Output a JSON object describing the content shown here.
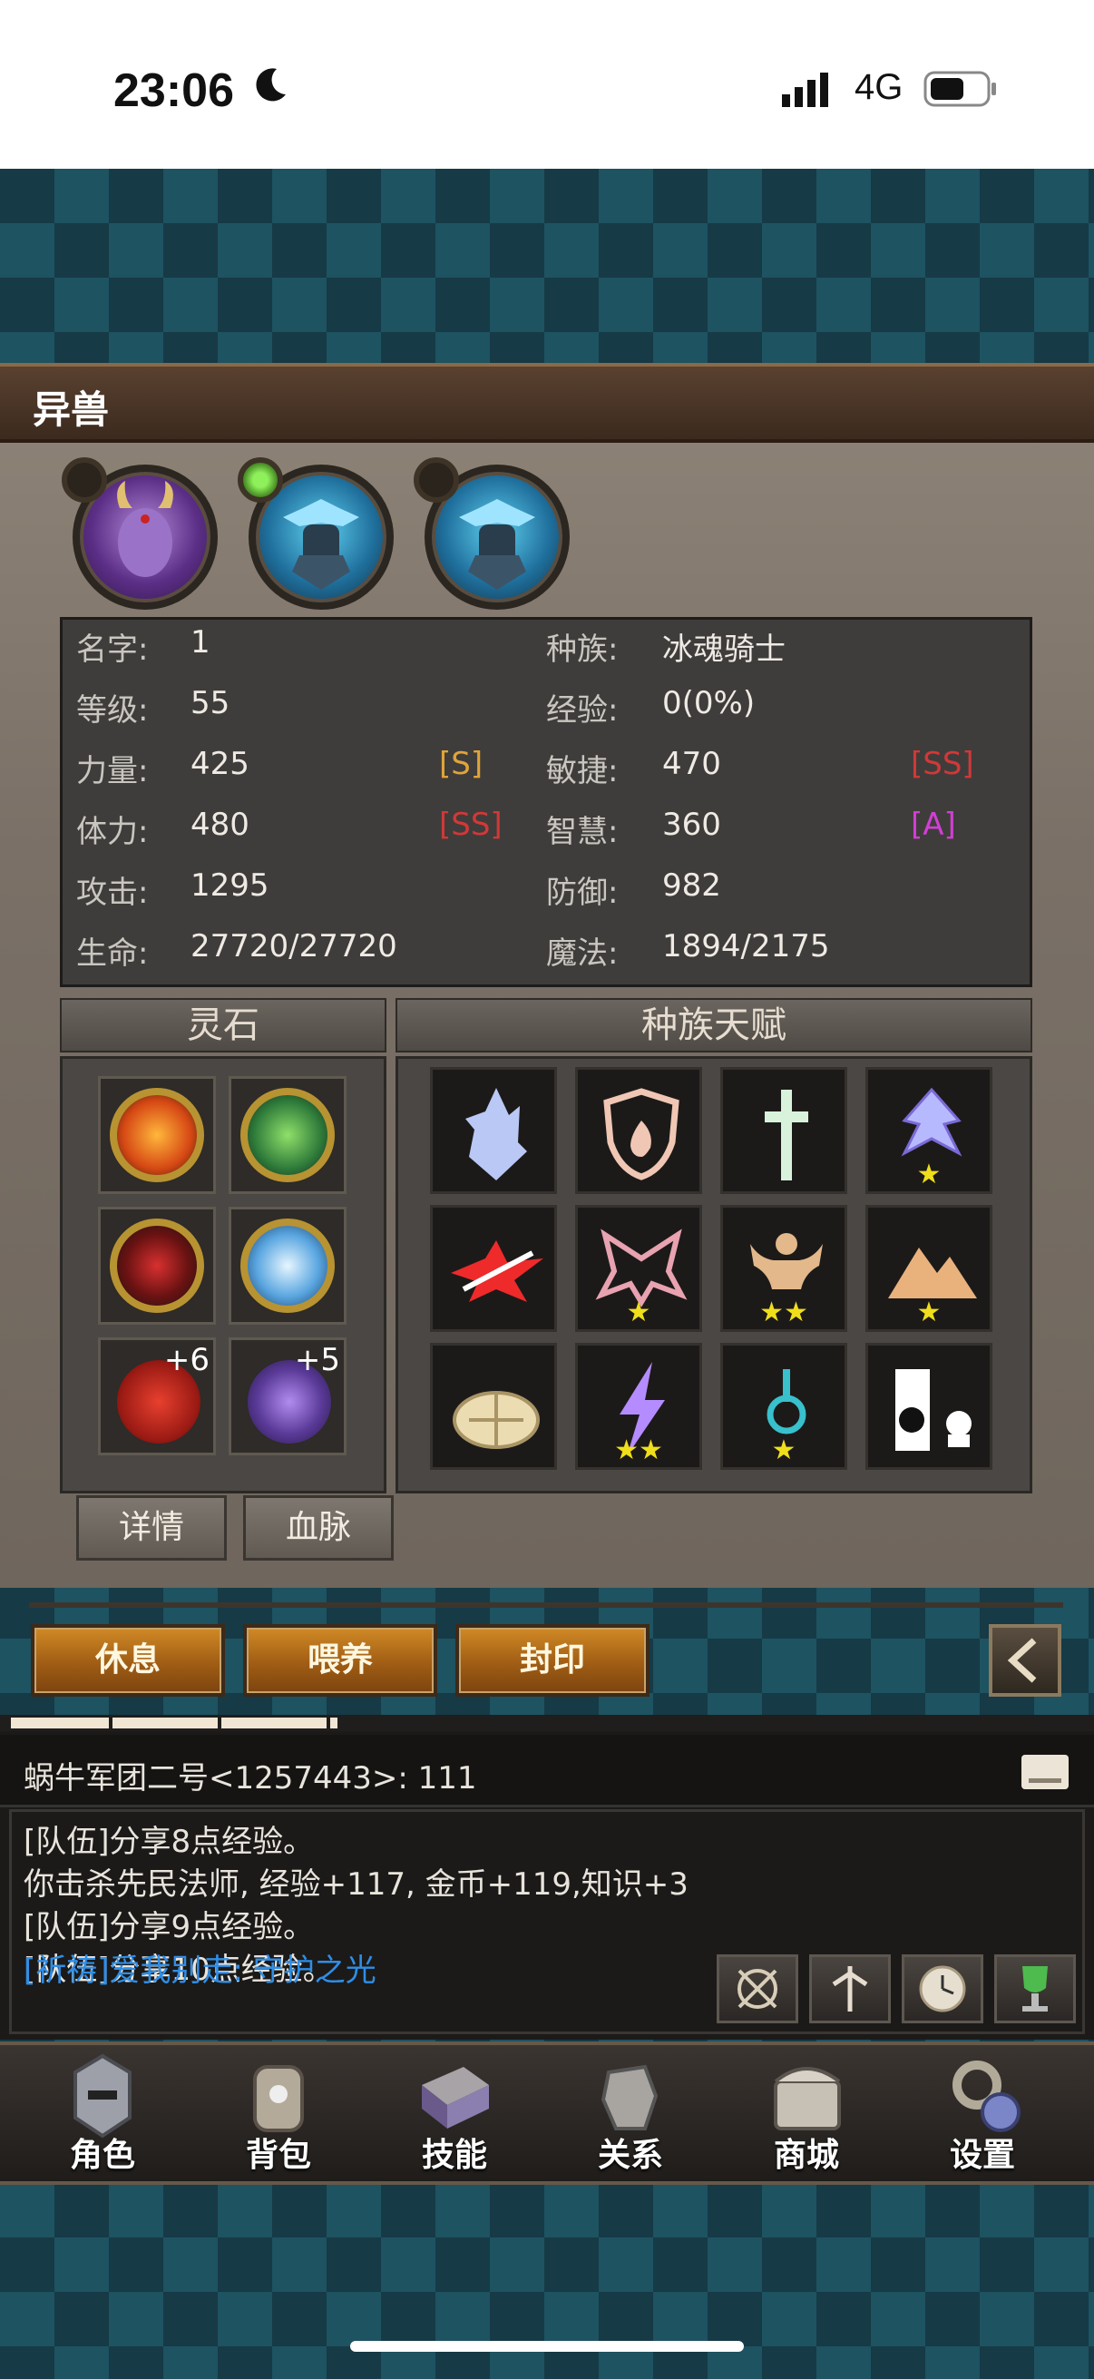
{
  "status_bar": {
    "time": "23:06",
    "network": "4G"
  },
  "window": {
    "title": "异兽"
  },
  "stats": {
    "rows": [
      {
        "l1": "名字:",
        "v1": "1",
        "g1": "",
        "l2": "种族:",
        "v2": "冰魂骑士",
        "g2": ""
      },
      {
        "l1": "等级:",
        "v1": "55",
        "g1": "",
        "l2": "经验:",
        "v2": "0(0%)",
        "g2": ""
      },
      {
        "l1": "力量:",
        "v1": "425",
        "g1": "[S]",
        "l2": "敏捷:",
        "v2": "470",
        "g2": "[SS]"
      },
      {
        "l1": "体力:",
        "v1": "480",
        "g1": "[SS]",
        "l2": "智慧:",
        "v2": "360",
        "g2": "[A]"
      },
      {
        "l1": "攻击:",
        "v1": "1295",
        "g1": "",
        "l2": "防御:",
        "v2": "982",
        "g2": ""
      },
      {
        "l1": "生命:",
        "v1": "27720/27720",
        "g1": "",
        "l2": "魔法:",
        "v2": "1894/2175",
        "g2": ""
      }
    ]
  },
  "spirit_stones": {
    "title": "灵石",
    "items": [
      {
        "icon": "fire-stone-icon",
        "plus": ""
      },
      {
        "icon": "leaf-stone-icon",
        "plus": ""
      },
      {
        "icon": "rune-stone-icon",
        "plus": ""
      },
      {
        "icon": "snow-stone-icon",
        "plus": ""
      },
      {
        "icon": "red-orb-icon",
        "plus": "+6"
      },
      {
        "icon": "purple-orb-icon",
        "plus": "+5"
      }
    ]
  },
  "race_talents": {
    "title": "种族天赋",
    "items": [
      {
        "icon": "ice-crystal-icon",
        "stars": ""
      },
      {
        "icon": "fire-shield-icon",
        "stars": ""
      },
      {
        "icon": "holy-cross-icon",
        "stars": ""
      },
      {
        "icon": "frost-emblem-icon",
        "stars": "★"
      },
      {
        "icon": "slash-icon",
        "stars": ""
      },
      {
        "icon": "demon-wings-icon",
        "stars": "★"
      },
      {
        "icon": "strength-icon",
        "stars": "★★"
      },
      {
        "icon": "mountain-icon",
        "stars": "★"
      },
      {
        "icon": "turtle-shell-icon",
        "stars": ""
      },
      {
        "icon": "lightning-icon",
        "stars": "★★"
      },
      {
        "icon": "aura-icon",
        "stars": "★"
      },
      {
        "icon": "silhouette-icon",
        "stars": ""
      }
    ]
  },
  "buttons": {
    "details": "详情",
    "bloodline": "血脉",
    "rest": "休息",
    "feed": "喂养",
    "seal": "封印"
  },
  "chat": {
    "header": "蜗牛军团二号<1257443>: 111",
    "lines": [
      "[队伍]分享8点经验。",
      "你击杀先民法师, 经验+117, 金币+119,知识+3",
      "[队伍]分享9点经验。",
      "[队伍]分享10点经验。"
    ],
    "prayer": "[祈祷]爱我别走: 守护之光"
  },
  "nav": {
    "items": [
      "角色",
      "背包",
      "技能",
      "关系",
      "商城",
      "设置"
    ]
  },
  "colors": {
    "grade_s": "#e0a43a",
    "grade_ss": "#d13838",
    "grade_a": "#d23ed6",
    "prayer": "#2f8ee6",
    "gold_button": "#b8701c"
  }
}
